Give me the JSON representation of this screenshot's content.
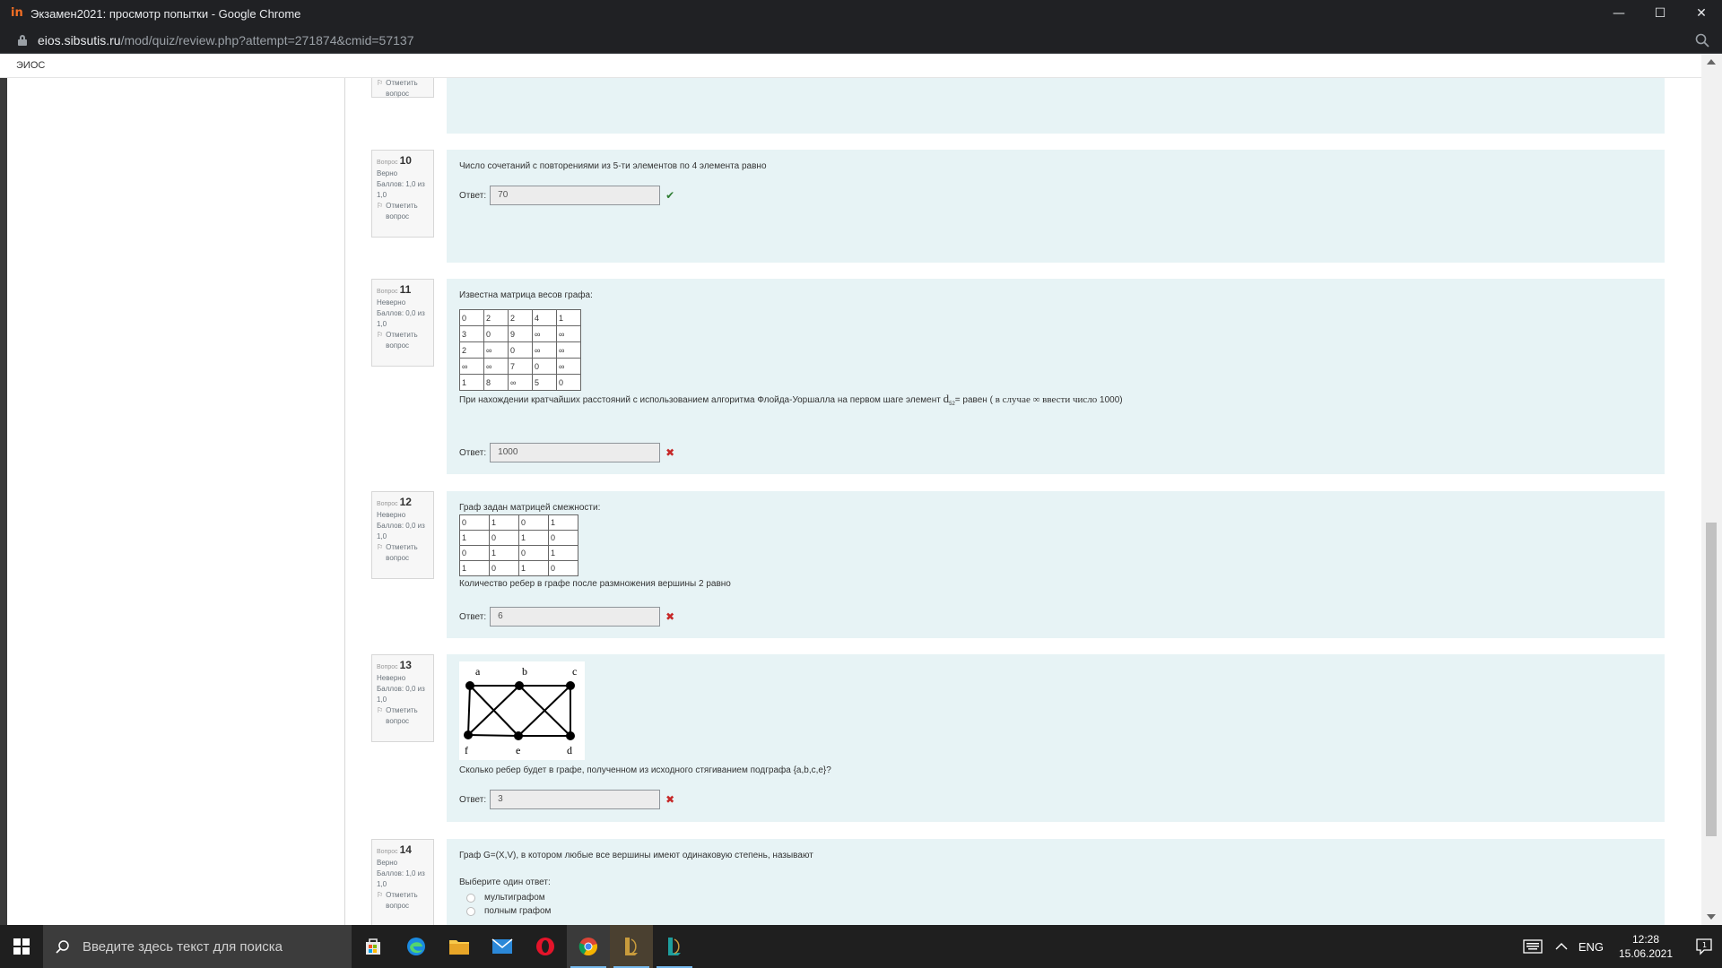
{
  "window": {
    "logo_text": "in",
    "title": "Экзамен2021: просмотр попытки - Google Chrome",
    "url_host": "eios.sibsutis.ru",
    "url_path": "/mod/quiz/review.php?attempt=271874&cmid=57137"
  },
  "site": {
    "brand": "ЭИОС"
  },
  "prev_question": {
    "flag_label": "Отметить вопрос"
  },
  "questions": [
    {
      "prefix": "Вопрос",
      "number": "10",
      "status": "Верно",
      "grade": "Баллов: 1,0 из 1,0",
      "flag_label": "Отметить вопрос",
      "text": "Число сочетаний с повторениями из 5-ти элементов по 4 элемента равно",
      "answer_label": "Ответ:",
      "answer": "70",
      "correct": true
    },
    {
      "prefix": "Вопрос",
      "number": "11",
      "status": "Неверно",
      "grade": "Баллов: 0,0 из 1,0",
      "flag_label": "Отметить вопрос",
      "text": "Известна матрица весов графа:",
      "matrix": [
        [
          "0",
          "2",
          "2",
          "4",
          "1"
        ],
        [
          "3",
          "0",
          "9",
          "∞",
          "∞"
        ],
        [
          "2",
          "∞",
          "0",
          "∞",
          "∞"
        ],
        [
          "∞",
          "∞",
          "7",
          "0",
          "∞"
        ],
        [
          "1",
          "8",
          "∞",
          "5",
          "0"
        ]
      ],
      "text2_a": "При нахождении кратчайших расстояний с использованием алгоритма Флойда-Уоршалла на первом шаге элемент ",
      "text2_d": "d",
      "text2_sub": "52",
      "text2_b": "= равен ( ",
      "text2_c": "в случае ∞ ввести число",
      "text2_d2": " 1000)",
      "answer_label": "Ответ:",
      "answer": "1000",
      "correct": false
    },
    {
      "prefix": "Вопрос",
      "number": "12",
      "status": "Неверно",
      "grade": "Баллов: 0,0 из 1,0",
      "flag_label": "Отметить вопрос",
      "text": "Граф задан матрицей смежности:",
      "matrix": [
        [
          "0",
          "1",
          "0",
          "1"
        ],
        [
          "1",
          "0",
          "1",
          "0"
        ],
        [
          "0",
          "1",
          "0",
          "1"
        ],
        [
          "1",
          "0",
          "1",
          "0"
        ]
      ],
      "text2": "Количество ребер в графе после размножения вершины 2 равно",
      "answer_label": "Ответ:",
      "answer": "6",
      "correct": false
    },
    {
      "prefix": "Вопрос",
      "number": "13",
      "status": "Неверно",
      "grade": "Баллов: 0,0 из 1,0",
      "flag_label": "Отметить вопрос",
      "graph_labels": [
        "a",
        "b",
        "c",
        "f",
        "e",
        "d"
      ],
      "text": "Сколько ребер будет в графе, полученном из исходного стягиванием подграфа {a,b,c,e}?",
      "answer_label": "Ответ:",
      "answer": "3",
      "correct": false
    },
    {
      "prefix": "Вопрос",
      "number": "14",
      "status": "Верно",
      "grade": "Баллов: 1,0 из 1,0",
      "flag_label": "Отметить вопрос",
      "text": "Граф G=(X,V), в котором любые все вершины имеют одинаковую степень, называют",
      "choose_label": "Выберите один ответ:",
      "options": [
        "мультиграфом",
        "полным графом"
      ]
    }
  ],
  "taskbar": {
    "search_placeholder": "Введите здесь текст для поиска",
    "lang": "ENG",
    "time": "12:28",
    "date": "15.06.2021",
    "notif_count": "1"
  },
  "colors": {
    "correct": "#2e7d32",
    "incorrect": "#c62828",
    "content_bg": "#e7f3f5"
  }
}
